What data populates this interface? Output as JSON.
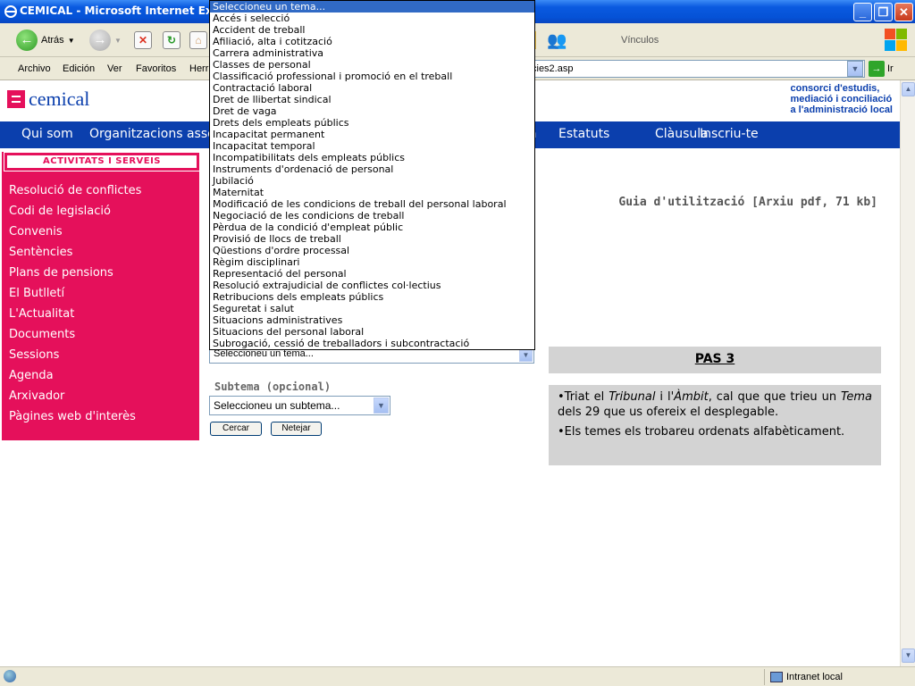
{
  "window": {
    "title": "CEMICAL - Microsoft Internet Explo"
  },
  "toolbar": {
    "back_label": "Atrás",
    "links_label": "Vínculos"
  },
  "menu": [
    "Archivo",
    "Edición",
    "Ver",
    "Favoritos",
    "Herr"
  ],
  "address": {
    "value": "cies2.asp",
    "go_label": "Ir"
  },
  "site": {
    "logo_text": "cemical",
    "tagline": [
      "consorci d'estudis,",
      "mediació i conciliació",
      "a l'administració local"
    ],
    "nav": [
      "Qui som",
      "Organitzacions asso",
      "Estatuts",
      "Clàusula",
      "Inscriu-te"
    ],
    "nav_hidden_fragment": "a"
  },
  "sidebar": {
    "header": "ACTIVITATS I SERVEIS",
    "items": [
      "Resolució de conflictes",
      "Codi de legislació",
      "Convenis",
      "Sentències",
      "Plans de pensions",
      "El Butlletí",
      "L'Actualitat",
      "Documents",
      "Sessions",
      "Agenda",
      "Arxivador",
      "Pàgines web d'interès"
    ]
  },
  "guide_link": "Guia d'utilització [Arxiu pdf, 71 kb]",
  "form": {
    "tema_selected": "Seleccioneu un tema...",
    "subtema_label": "Subtema (opcional)",
    "subtema_selected": "Seleccioneu un subtema...",
    "search_button": "Cercar",
    "clear_button": "Netejar"
  },
  "tema_options": [
    "Seleccioneu un tema...",
    "Accés i selecció",
    "Accident de treball",
    "Afiliació, alta i cotització",
    "Carrera administrativa",
    "Classes de personal",
    "Classificació professional i promoció en el treball",
    "Contractació laboral",
    "Dret de llibertat sindical",
    "Dret de vaga",
    "Drets dels empleats públics",
    "Incapacitat permanent",
    "Incapacitat temporal",
    "Incompatibilitats dels empleats públics",
    "Instruments d'ordenació de personal",
    "Jubilació",
    "Maternitat",
    "Modificació de les condicions de treball del personal laboral",
    "Negociació de les condicions de treball",
    "Pèrdua de la condició d'empleat públic",
    "Provisió de llocs de treball",
    "Qüestions d'ordre processal",
    "Règim disciplinari",
    "Representació del personal",
    "Resolució extrajudicial de conflictes col·lectius",
    "Retribucions dels empleats públics",
    "Seguretat i salut",
    "Situacions administratives",
    "Situacions del personal laboral",
    "Subrogació, cessió de treballadors i subcontractació"
  ],
  "pas3": {
    "title": "PAS 3",
    "p1_pre": "•Triat el ",
    "p1_em1": "Tribunal",
    "p1_mid": " i l'",
    "p1_em2": "Àmbit",
    "p1_mid2": ", cal que que trieu un ",
    "p1_em3": "Tema",
    "p1_post": " dels 29 que us ofereix el desplegable.",
    "p2": "•Els temes els trobareu ordenats alfabèticament."
  },
  "status": {
    "zone": "Intranet local"
  },
  "colors": {
    "brand_pink": "#e5105b",
    "brand_blue": "#0b3fad",
    "selection": "#316ac5"
  }
}
